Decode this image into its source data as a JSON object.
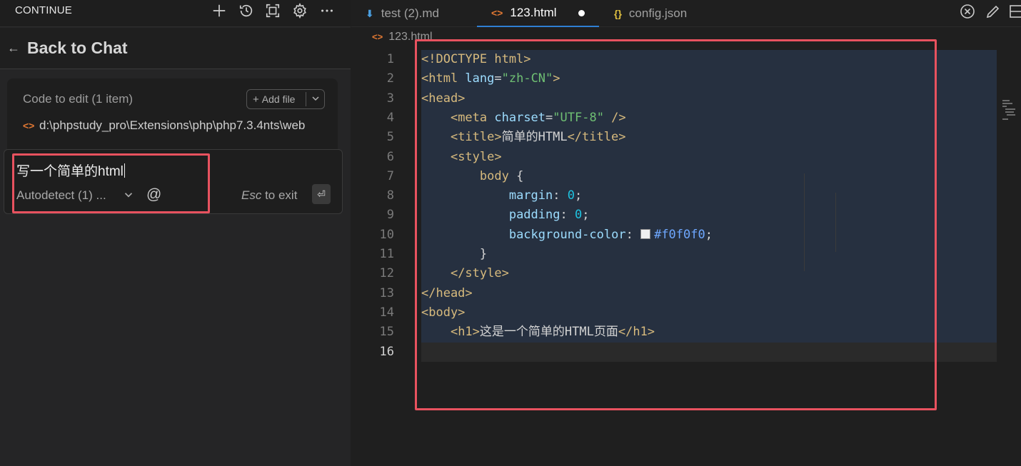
{
  "left_panel": {
    "title": "CONTINUE",
    "toolbar_icons": [
      "plus-icon",
      "history-icon",
      "fullscreen-icon",
      "gear-icon",
      "more-icon"
    ],
    "back_label": "Back to Chat",
    "code_to_edit": {
      "title": "Code to edit (1 item)",
      "add_file_label": "Add file",
      "file_icon": "<>",
      "file_path": "d:\\phpstudy_pro\\Extensions\\php\\php7.3.4nts\\web"
    },
    "input": {
      "value": "写一个简单的html",
      "model_select": "Autodetect (1) ...",
      "at_symbol": "@",
      "esc_key": "Esc",
      "esc_text": " to exit",
      "enter_symbol": "⏎"
    }
  },
  "editor": {
    "tabs": [
      {
        "icon": "⬇",
        "label": "test (2).md",
        "color": "#4a9fe0"
      },
      {
        "icon": "<>",
        "label": "123.html",
        "color": "#e37933",
        "active": true,
        "modified": true
      },
      {
        "icon": "{}",
        "label": "config.json",
        "color": "#e0c040"
      }
    ],
    "breadcrumb": {
      "icon": "<>",
      "file": "123.html"
    },
    "current_line": 16,
    "lines": [
      {
        "n": "1",
        "tokens": [
          [
            "t",
            "<!DOCTYPE html>"
          ]
        ]
      },
      {
        "n": "2",
        "tokens": [
          [
            "t",
            "<html "
          ],
          [
            "a",
            "lang"
          ],
          [
            "p",
            "="
          ],
          [
            "s",
            "\"zh-CN\""
          ],
          [
            "t",
            ">"
          ]
        ]
      },
      {
        "n": "3",
        "tokens": [
          [
            "t",
            "<head>"
          ]
        ]
      },
      {
        "n": "4",
        "tokens": [
          [
            "p",
            "    "
          ],
          [
            "t",
            "<meta "
          ],
          [
            "a",
            "charset"
          ],
          [
            "p",
            "="
          ],
          [
            "s",
            "\"UTF-8\""
          ],
          [
            "t",
            " />"
          ]
        ]
      },
      {
        "n": "5",
        "tokens": [
          [
            "p",
            "    "
          ],
          [
            "t",
            "<title>"
          ],
          [
            "p",
            "简单的HTML"
          ],
          [
            "t",
            "</title>"
          ]
        ]
      },
      {
        "n": "6",
        "tokens": [
          [
            "p",
            "    "
          ],
          [
            "t",
            "<style>"
          ]
        ]
      },
      {
        "n": "7",
        "tokens": [
          [
            "p",
            "        "
          ],
          [
            "t",
            "body "
          ],
          [
            "p",
            "{"
          ]
        ]
      },
      {
        "n": "8",
        "tokens": [
          [
            "p",
            "            "
          ],
          [
            "a",
            "margin"
          ],
          [
            "p",
            ": "
          ],
          [
            "n",
            "0"
          ],
          [
            "p",
            ";"
          ]
        ]
      },
      {
        "n": "9",
        "tokens": [
          [
            "p",
            "            "
          ],
          [
            "a",
            "padding"
          ],
          [
            "p",
            ": "
          ],
          [
            "n",
            "0"
          ],
          [
            "p",
            ";"
          ]
        ]
      },
      {
        "n": "10",
        "tokens": [
          [
            "p",
            "            "
          ],
          [
            "a",
            "background-color"
          ],
          [
            "p",
            ": "
          ],
          [
            "swatch",
            ""
          ],
          [
            "c",
            "#f0f0f0"
          ],
          [
            "p",
            ";"
          ]
        ]
      },
      {
        "n": "11",
        "tokens": [
          [
            "p",
            "        "
          ],
          [
            "p",
            "}"
          ]
        ]
      },
      {
        "n": "12",
        "tokens": [
          [
            "p",
            "    "
          ],
          [
            "t",
            "</style>"
          ]
        ]
      },
      {
        "n": "13",
        "tokens": [
          [
            "t",
            "</head>"
          ]
        ]
      },
      {
        "n": "14",
        "tokens": [
          [
            "t",
            "<body>"
          ]
        ]
      },
      {
        "n": "15",
        "tokens": [
          [
            "p",
            "    "
          ],
          [
            "t",
            "<h1>"
          ],
          [
            "p",
            "这是一个简单的HTML页面"
          ],
          [
            "t",
            "</h1>"
          ]
        ]
      },
      {
        "n": "16",
        "tokens": []
      }
    ]
  },
  "colors": {
    "highlight_box": "#e8525f",
    "active_tab_underline": "#2f7fd3",
    "selection_bg": "#263040"
  }
}
